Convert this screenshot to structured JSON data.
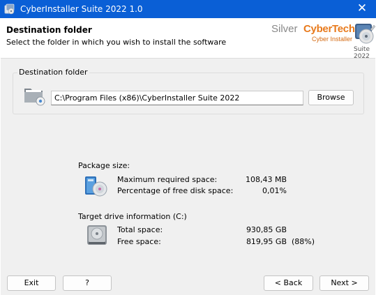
{
  "window": {
    "title": "CyberInstaller Suite 2022 1.0",
    "close_glyph": "✕"
  },
  "header": {
    "title": "Destination folder",
    "subtitle": "Select the folder in which you wish to install the software",
    "logo": {
      "brand_part1": "Silver",
      "brand_part2": "CyberTech",
      "product": "Cyber Installer",
      "edition": "Suite 2022",
      "accent_color": "#e87a1c"
    }
  },
  "destination": {
    "group_label": "Destination folder",
    "path_value": "C:\\Program Files (x86)\\CyberInstaller Suite 2022",
    "browse_label": "Browse",
    "icon": "folder-with-disc-icon"
  },
  "package": {
    "label": "Package size:",
    "icon": "package-disc-icon",
    "rows": [
      {
        "label": "Maximum required space:",
        "value": "108,43 MB"
      },
      {
        "label": "Percentage of free disk space:",
        "value": "0,01%"
      }
    ]
  },
  "drive": {
    "label": "Target drive information (C:)",
    "icon": "hard-drive-icon",
    "rows": [
      {
        "label": "Total space:",
        "value": "930,85 GB",
        "extra": ""
      },
      {
        "label": "Free space:",
        "value": "819,95 GB",
        "extra": "(88%)"
      }
    ]
  },
  "footer": {
    "exit_label": "Exit",
    "help_label": "?",
    "back_label": "< Back",
    "next_label": "Next >"
  },
  "colors": {
    "titlebar": "#0a5fd6",
    "panel": "#f0f0f0"
  }
}
